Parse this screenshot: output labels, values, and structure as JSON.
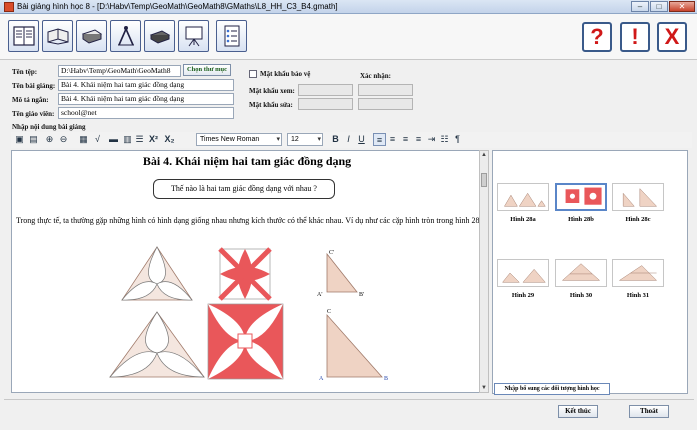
{
  "window": {
    "title": "Bài giảng hình học 8 - [D:\\Habv\\Temp\\GeoMath\\GeoMath8\\GMaths\\L8_HH_C3_B4.gmath]",
    "minimize": "–",
    "maximize": "□",
    "close": "✕"
  },
  "toolbar": {
    "icons": [
      "lesson-list-icon",
      "open-book-icon",
      "closed-book-icon",
      "compass-icon",
      "notebook-icon",
      "projector-icon",
      "checklist-icon"
    ],
    "help_label": "?",
    "alert_label": "!",
    "exit_label": "X"
  },
  "form": {
    "file_label": "Tên tệp:",
    "file_value": "D:\\Habv\\Temp\\GeoMath\\GeoMath8",
    "choose_folder_label": "Chọn thư mục",
    "lesson_label": "Tên bài giảng:",
    "lesson_value": "Bài 4. Khái niệm hai tam giác đồng dạng",
    "desc_label": "Mô tả ngắn:",
    "desc_value": "Bài 4. Khái niệm hai tam giác đồng dạng",
    "teacher_label": "Tên giáo viên:",
    "teacher_value": "school@net",
    "password_protect_label": "Mật khẩu bảo vệ",
    "confirm_label": "Xác nhận:",
    "view_pwd_label": "Mật khẩu xem:",
    "edit_pwd_label": "Mật khẩu sửa:"
  },
  "editor": {
    "section_label": "Nhập nội dung bài giảng",
    "font_name": "Times New Roman",
    "font_size": "12",
    "bold": "B",
    "italic": "I",
    "underline": "U",
    "superscript": "X²",
    "subscript": "X₂",
    "paragraph": "¶",
    "doc_title": "Bài 4. Khái niệm hai tam giác đồng dạng",
    "question": "Thế nào là hai tam giác đồng dạng với nhau ?",
    "paragraph_text": "Trong thực tế, ta thường gặp những hình có hình dạng giống nhau nhưng kích thước có thể khác nhau. Ví dụ như các cặp hình tròn trong hình 28.",
    "small_triangle_labels": [
      "C'",
      "A'",
      "B'"
    ],
    "big_triangle_labels": [
      "C",
      "A",
      "B"
    ]
  },
  "side_panel": {
    "items": [
      {
        "caption": "Hình 28a"
      },
      {
        "caption": "Hình 28b"
      },
      {
        "caption": "Hình 28c"
      },
      {
        "caption": "Hình 29"
      },
      {
        "caption": "Hình 30"
      },
      {
        "caption": "Hình 31"
      }
    ],
    "add_objects_label": "Nhập bổ sung các đối tượng hình học"
  },
  "footer": {
    "finish_label": "Kết thúc",
    "exit_label": "Thoát"
  },
  "colors": {
    "accent": "#e9575a",
    "beige": "#efd3c4",
    "red_button": "#d01818"
  }
}
